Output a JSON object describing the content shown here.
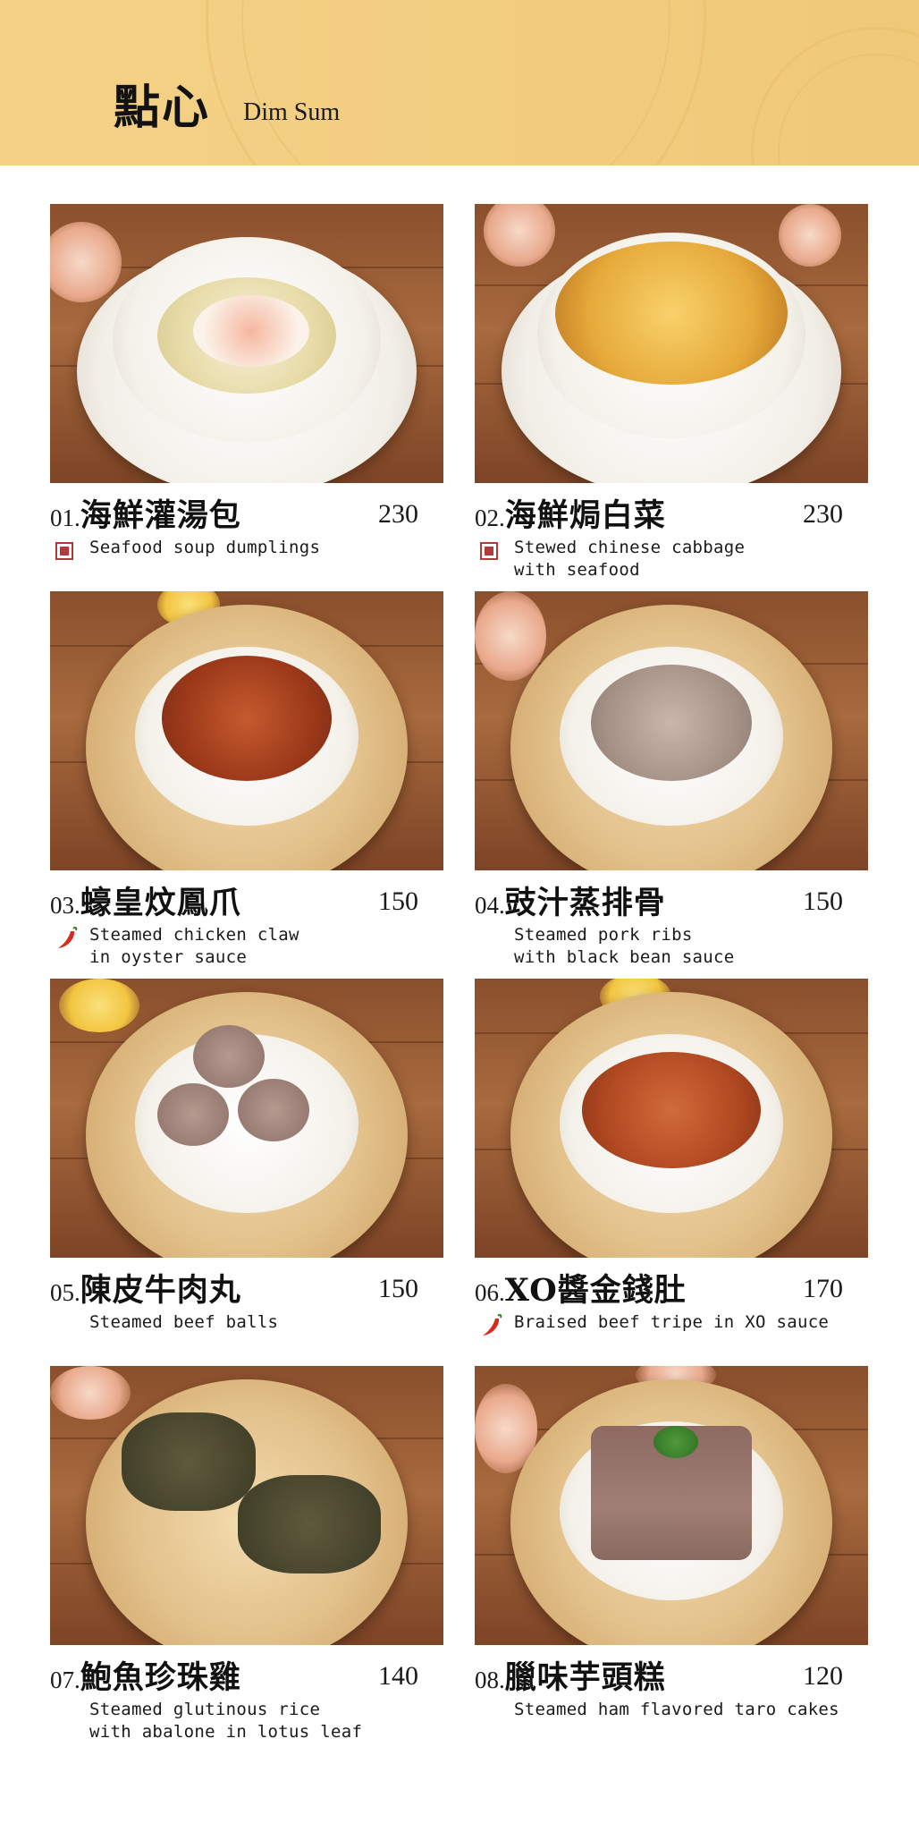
{
  "header": {
    "title": "點心",
    "subtitle": "Dim Sum",
    "background_color": "#f2cd80"
  },
  "items": [
    {
      "number": "01.",
      "name_zh": "海鮮灌湯包",
      "price": "230",
      "desc_lines": [
        "Seafood soup dumplings"
      ],
      "badge": "seafood-icon",
      "dish": "soup-bowl"
    },
    {
      "number": "02.",
      "name_zh": "海鮮焗白菜",
      "price": "230",
      "desc_lines": [
        "Stewed chinese cabbage",
        "with seafood"
      ],
      "badge": "seafood-icon",
      "dish": "baked-casserole"
    },
    {
      "number": "03.",
      "name_zh": "蠔皇炆鳳爪",
      "price": "150",
      "desc_lines": [
        "Steamed chicken claw",
        "in oyster sauce"
      ],
      "badge": "chili-icon",
      "dish": "steamer-basket"
    },
    {
      "number": "04.",
      "name_zh": "豉汁蒸排骨",
      "price": "150",
      "desc_lines": [
        "Steamed pork ribs",
        "with black bean sauce"
      ],
      "badge": "",
      "dish": "steamer-basket"
    },
    {
      "number": "05.",
      "name_zh": "陳皮牛肉丸",
      "price": "150",
      "desc_lines": [
        "Steamed beef balls"
      ],
      "badge": "",
      "dish": "steamer-basket"
    },
    {
      "number": "06.",
      "name_zh": "XO醬金錢肚",
      "price": "170",
      "desc_lines": [
        "Braised beef tripe in XO sauce"
      ],
      "badge": "chili-icon",
      "dish": "steamer-basket"
    },
    {
      "number": "07.",
      "name_zh": "鮑魚珍珠雞",
      "price": "140",
      "desc_lines": [
        "Steamed glutinous rice",
        "with abalone in lotus leaf"
      ],
      "badge": "",
      "dish": "steamer-basket"
    },
    {
      "number": "08.",
      "name_zh": "臘味芋頭糕",
      "price": "120",
      "desc_lines": [
        "Steamed ham flavored taro cakes"
      ],
      "badge": "",
      "dish": "steamer-basket"
    }
  ]
}
